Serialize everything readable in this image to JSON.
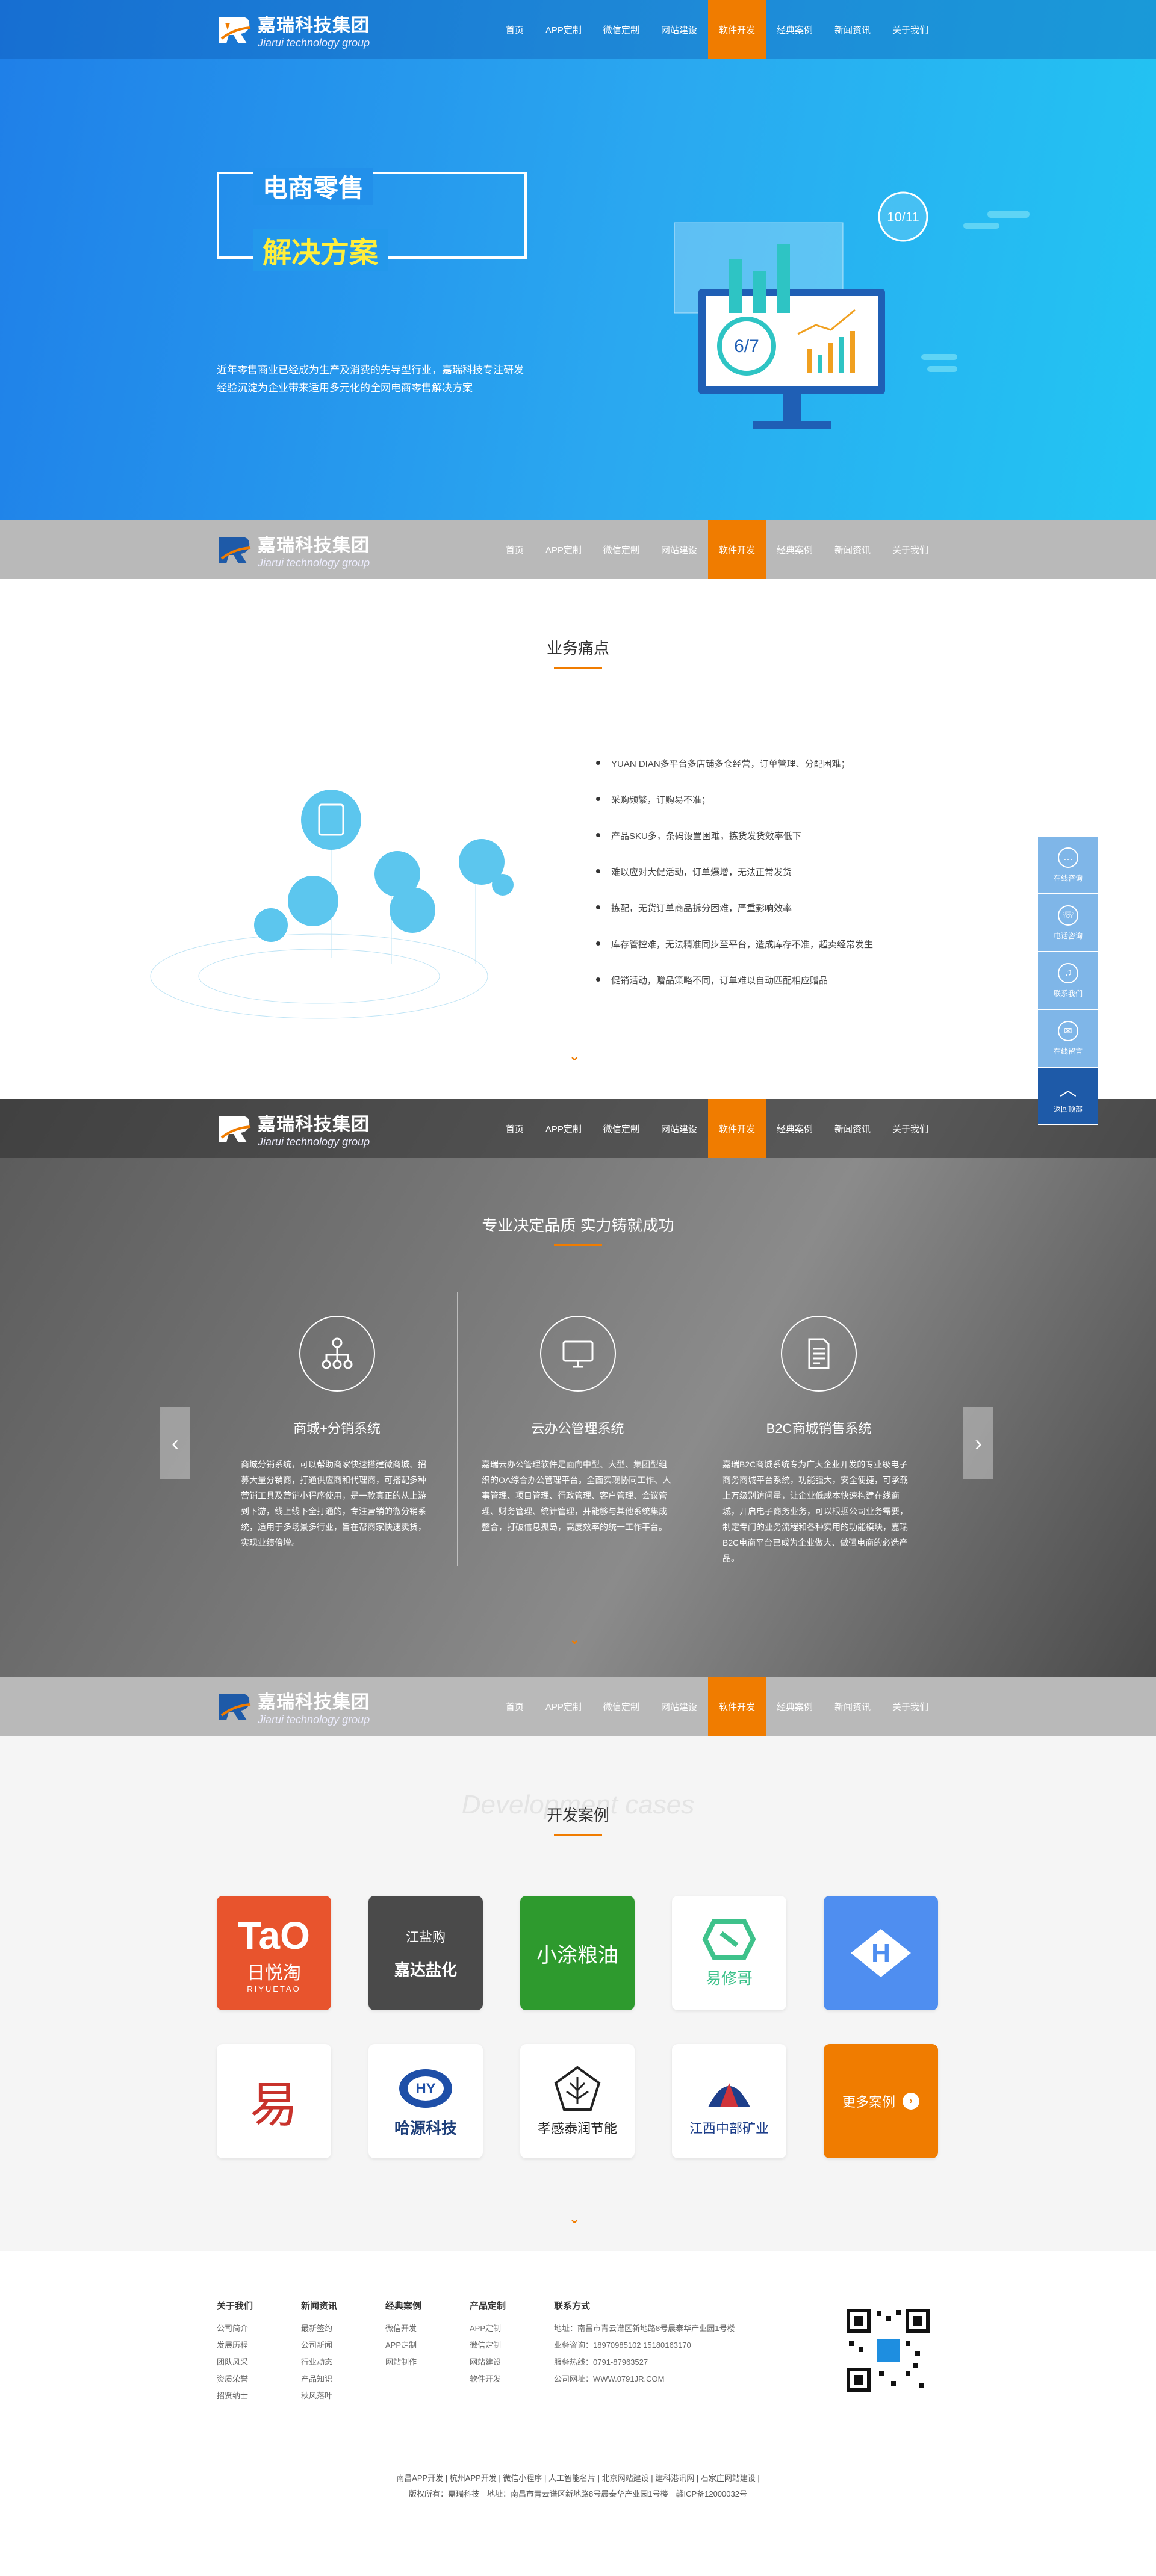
{
  "brand": {
    "name_cn": "嘉瑞科技集团",
    "name_en": "Jiarui technology group"
  },
  "nav": [
    "首页",
    "APP定制",
    "微信定制",
    "网站建设",
    "软件开发",
    "经典案例",
    "新闻资讯",
    "关于我们"
  ],
  "hero": {
    "title1": "电商零售",
    "title2": "解决方案",
    "desc": "近年零售商业已经成为生产及消费的先导型行业，嘉瑞科技专注研发经验沉淀为企业带来适用多元化的全网电商零售解决方案",
    "calendar_badge": "10/11",
    "screen_badge": "6/7"
  },
  "pain": {
    "title": "业务痛点",
    "items": [
      "YUAN DIAN多平台多店铺多仓经营，订单管理、分配困难；",
      "采购频繁，订购易不准；",
      "产品SKU多，条码设置困难，拣货发货效率低下",
      "难以应对大促活动，订单爆增，无法正常发货",
      "拣配，无货订单商品拆分困难，严重影响效率",
      "库存管控难，无法精准同步至平台，造成库存不准，超卖经常发生",
      "促销活动，赠品策略不同，订单难以自动匹配相应赠品"
    ]
  },
  "float": {
    "items": [
      "在线咨询",
      "电话咨询",
      "联系我们",
      "在线留言"
    ],
    "top": "返回顶部"
  },
  "quality": {
    "title": "专业决定品质 实力铸就成功",
    "cols": [
      {
        "name": "商城+分销系统",
        "desc": "商城分销系统，可以帮助商家快速搭建微商城、招募大量分销商，打通供应商和代理商，可搭配多种营销工具及营销小程序使用，是一款真正的从上游到下游，线上线下全打通的，专注营销的微分销系统，适用于多场景多行业，旨在帮商家快速卖货，实现业绩倍增。"
      },
      {
        "name": "云办公管理系统",
        "desc": "嘉瑞云办公管理软件是面向中型、大型、集团型组织的OA综合办公管理平台。全面实现协同工作、人事管理、项目管理、行政管理、客户管理、会议管理、财务管理、统计管理，并能够与其他系统集成整合，打破信息孤岛，高度效率的统一工作平台。"
      },
      {
        "name": "B2C商城销售系统",
        "desc": "嘉瑞B2C商城系统专为广大企业开发的专业级电子商务商城平台系统，功能强大，安全便捷，可承载上万级别访问量，让企业低成本快速构建在线商城，开启电子商务业务，可以根据公司业务需要，制定专门的业务流程和各种实用的功能模块，嘉瑞B2C电商平台已成为企业做大、做强电商的必选产品。"
      }
    ]
  },
  "cases": {
    "title": "开发案例",
    "watermark": "Development cases",
    "items": [
      {
        "name": "日悦淘",
        "sub": "RIYUETAO",
        "bg": "#e8542d"
      },
      {
        "name": "嘉达盐化",
        "sub": "江盐购",
        "bg": "#4a4a4a"
      },
      {
        "name": "小涂粮油",
        "sub": "",
        "bg": "#2e9a2e"
      },
      {
        "name": "易修哥",
        "sub": "",
        "bg": "#ffffff"
      },
      {
        "name": "",
        "sub": "",
        "bg": "#4f8ef0"
      },
      {
        "name": "易",
        "sub": "",
        "bg": "#ffffff"
      },
      {
        "name": "哈源科技",
        "sub": "",
        "bg": "#ffffff"
      },
      {
        "name": "孝感泰润节能",
        "sub": "",
        "bg": "#ffffff"
      },
      {
        "name": "江西中部矿业",
        "sub": "",
        "bg": "#ffffff"
      },
      {
        "name": "更多案例",
        "sub": "",
        "bg": "#f07c00"
      }
    ]
  },
  "footer": {
    "cols": [
      {
        "title": "关于我们",
        "items": [
          "公司简介",
          "发展历程",
          "团队风采",
          "资质荣誉",
          "招贤纳士"
        ]
      },
      {
        "title": "新闻资讯",
        "items": [
          "最新签约",
          "公司新闻",
          "行业动态",
          "产品知识",
          "秋风落叶"
        ]
      },
      {
        "title": "经典案例",
        "items": [
          "微信开发",
          "APP定制",
          "网站制作"
        ]
      },
      {
        "title": "产品定制",
        "items": [
          "APP定制",
          "微信定制",
          "网站建设",
          "软件开发"
        ]
      }
    ],
    "contact": {
      "title": "联系方式",
      "lines": [
        "地址：南昌市青云谱区新地路8号晨泰华产业园1号楼",
        "业务咨询：18970985102 15180163170",
        "服务热线：0791-87963527",
        "公司网址：WWW.0791JR.COM"
      ]
    },
    "bottom1": "南昌APP开发 | 杭州APP开发 | 微信小程序 | 人工智能名片 | 北京网站建设 | 建科港讯网 | 石家庄网站建设 |",
    "bottom2": "版权所有：嘉瑞科技　地址：南昌市青云谱区新地路8号晨泰华产业园1号楼　赣ICP备12000032号"
  },
  "colors": {
    "accent": "#f07c00",
    "hero_blue": "#2aa8f0",
    "dark_blue": "#1e5aa8"
  }
}
